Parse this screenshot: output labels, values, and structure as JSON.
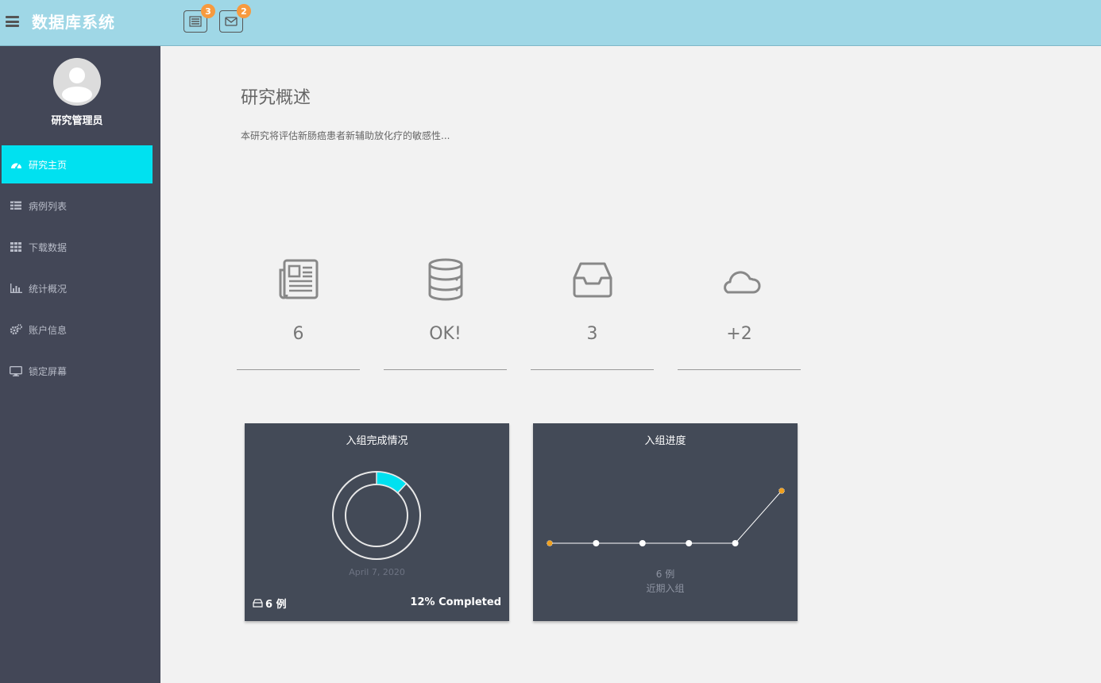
{
  "header": {
    "title": "数据库系统",
    "notifications": [
      {
        "icon": "list-icon",
        "count": "3"
      },
      {
        "icon": "envelope-icon",
        "count": "2"
      }
    ]
  },
  "sidebar": {
    "user_name": "研究管理员",
    "items": [
      {
        "label": "研究主页",
        "icon": "dashboard-icon",
        "active": true
      },
      {
        "label": "病例列表",
        "icon": "list-icon",
        "active": false
      },
      {
        "label": "下载数据",
        "icon": "grid-icon",
        "active": false
      },
      {
        "label": "统计概况",
        "icon": "bar-chart-icon",
        "active": false
      },
      {
        "label": "账户信息",
        "icon": "gears-icon",
        "active": false
      },
      {
        "label": "锁定屏幕",
        "icon": "monitor-icon",
        "active": false
      }
    ]
  },
  "main": {
    "title": "研究概述",
    "description": "本研究将评估新肠癌患者新辅助放化疗的敏感性...",
    "stats": [
      {
        "icon": "newspaper-icon",
        "value": "6"
      },
      {
        "icon": "database-icon",
        "value": "OK!"
      },
      {
        "icon": "inbox-icon",
        "value": "3"
      },
      {
        "icon": "cloud-icon",
        "value": "+2"
      }
    ]
  },
  "cards": {
    "completion": {
      "title": "入组完成情况",
      "date": "April 7, 2020",
      "count": "6 例",
      "completed": "12% Completed"
    },
    "progress": {
      "title": "入组进度",
      "value": "6 例",
      "label": "近期入组"
    }
  },
  "colors": {
    "accent": "#00e1f0",
    "header_bg": "#9fd7e6",
    "sidebar_bg": "#434757",
    "card_bg": "#434a57",
    "badge": "#f79a3e",
    "point_highlight": "#f0a01e"
  },
  "chart_data": [
    {
      "type": "pie",
      "title": "入组完成情况",
      "values": [
        12,
        88
      ]
    },
    {
      "type": "line",
      "title": "入组进度",
      "x": [
        1,
        2,
        3,
        4,
        5,
        6
      ],
      "values": [
        0,
        0,
        0,
        0,
        0,
        6
      ]
    }
  ]
}
